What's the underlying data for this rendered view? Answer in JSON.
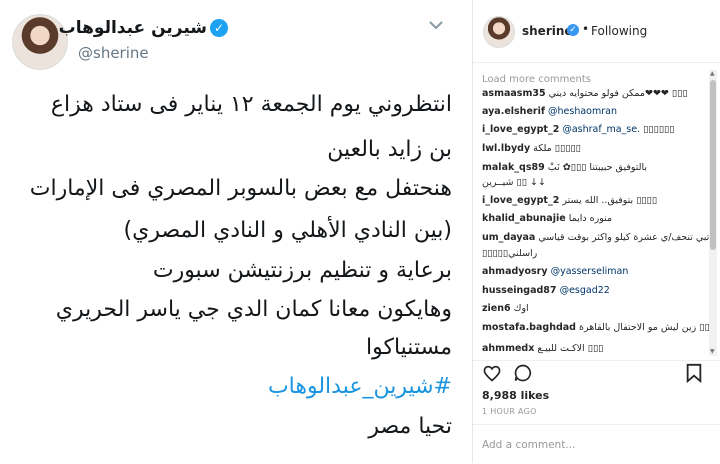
{
  "tweet": {
    "name": "شيرين عبدالوهاب",
    "handle": "@sherine",
    "verified_mark": "✓",
    "menu_icon": "chevron-down-icon",
    "lines": [
      "انتظروني يوم الجمعة ١٢ يناير فى ستاد هزاع",
      "بن زايد بالعين",
      "هنحتفل مع بعض بالسوبر المصري فى الإمارات",
      "(بين النادي الأهلي و النادي المصري)",
      "برعاية و تنظيم برزنتيشن سبورت",
      "وهايكون معانا كمان الدي جي ياسر الحريري",
      "مستنياكوا"
    ],
    "hashtag": "#شيرين_عبدالوهاب",
    "closing": "تحيا مصر"
  },
  "instagram": {
    "username": "sherine",
    "verified_mark": "✓",
    "separator": "•",
    "follow_status": "Following",
    "load_more": "Load more comments",
    "comments": [
      {
        "user": "asmaasm35",
        "text": "ممكن فولو محتوايه ديني❤❤❤ ▯▯▯",
        "mention": ""
      },
      {
        "user": "aya.elsherif",
        "text": "",
        "mention": "@heshaomran"
      },
      {
        "user": "i_love_egypt_2",
        "text": " ▯▯▯▯▯▯",
        "mention": "@ashraf_ma_se."
      },
      {
        "user": "lwl.lbydy",
        "text": "ملكة ▯▯▯▯▯",
        "mention": ""
      },
      {
        "user": "malak_qs89",
        "text": "بالتوفيق حبيبتنا ▯▯▯✿ نَبْ",
        "mention": ""
      },
      {
        "user": "",
        "text": "شيــرين ▯▯ ↓↓",
        "mention": ""
      },
      {
        "user": "i_love_egypt_2",
        "text": "بتوفيق.. الله يستر ▯▯▯▯",
        "mention": ""
      },
      {
        "user": "khalid_abunajie",
        "text": "منوره دايما",
        "mention": ""
      },
      {
        "user": "um_dayaa",
        "text": "تبي تنحف/ي عشرة كيلو واكثر بوقت قياسي",
        "mention": ""
      },
      {
        "user": "",
        "text": "▯▯▯▯▯راسلني",
        "mention": ""
      },
      {
        "user": "ahmadyosry",
        "text": "",
        "mention": "@yasserseliman"
      },
      {
        "user": "husseingad87",
        "text": "",
        "mention": "@esgad22"
      },
      {
        "user": "zien6",
        "text": "اوك",
        "mention": ""
      },
      {
        "user": "mostafa.baghdad",
        "text": "زين ليش مو الاحتفال بالقاهرة ▯▯▯",
        "mention": ""
      },
      {
        "user": "ahmmedx",
        "text": "الاكـت للبيـع ▯▯▯",
        "mention": ""
      }
    ],
    "actions": {
      "like_icon": "heart-icon",
      "comment_icon": "comment-icon",
      "save_icon": "bookmark-icon"
    },
    "likes": "8,988 likes",
    "time": "1 HOUR AGO",
    "add_comment_placeholder": "Add a comment..."
  }
}
